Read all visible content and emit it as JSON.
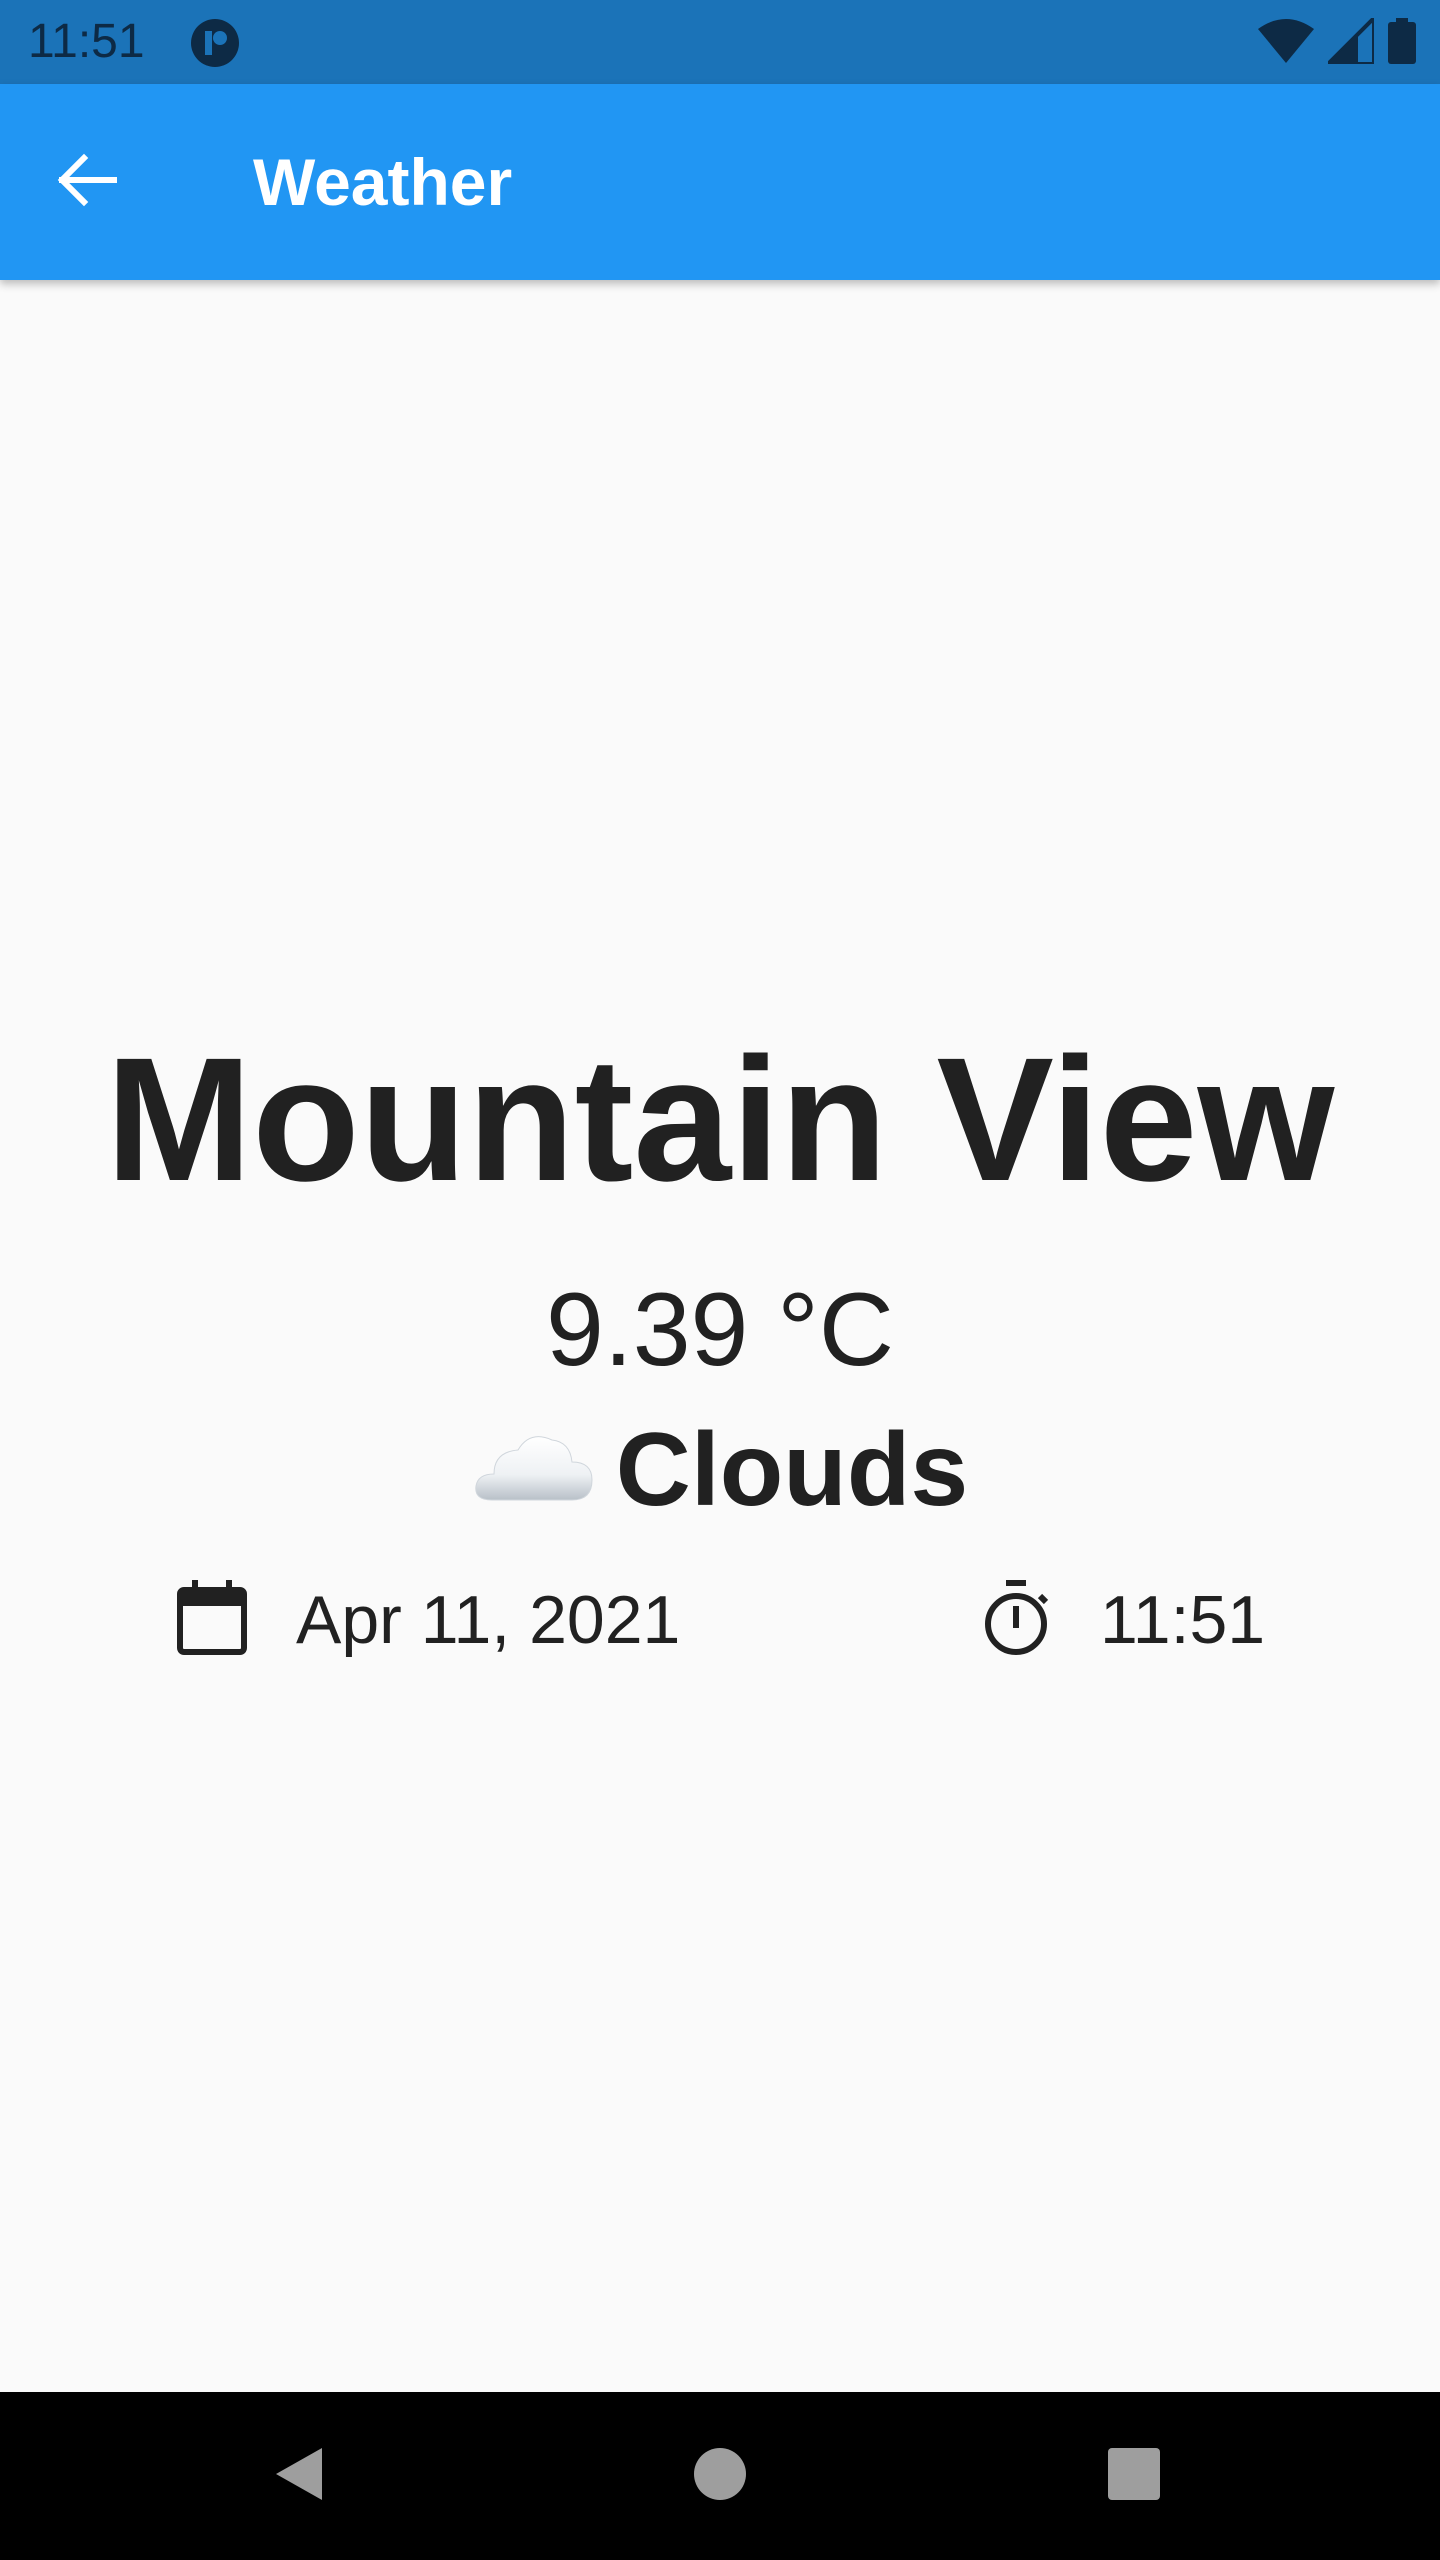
{
  "status_bar": {
    "time": "11:51",
    "app_icon": "notification-app-icon",
    "icons": [
      "wifi-icon",
      "signal-icon",
      "battery-icon"
    ]
  },
  "app_bar": {
    "title": "Weather",
    "back_icon": "arrow-back-icon"
  },
  "weather": {
    "city": "Mountain View",
    "temperature": "9.39 °C",
    "condition_emoji": "☁️",
    "condition": "Clouds",
    "date": "Apr 11, 2021",
    "time": "11:51",
    "date_icon": "calendar-icon",
    "time_icon": "timer-icon"
  },
  "nav_bar": {
    "buttons": [
      "back-triangle-icon",
      "home-circle-icon",
      "recents-square-icon"
    ]
  },
  "colors": {
    "status_bar": "#1b73b8",
    "app_bar": "#2196f3",
    "background": "#fafafa",
    "text": "#212121"
  }
}
